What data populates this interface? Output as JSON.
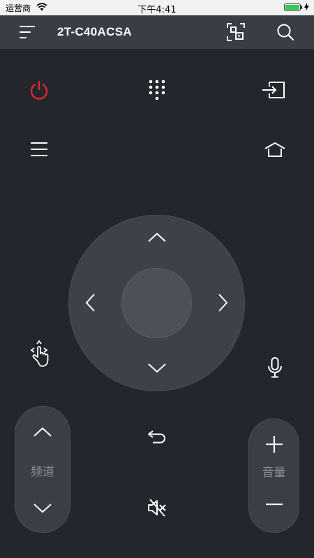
{
  "status_bar": {
    "carrier": "运营商",
    "time": "下午4:41"
  },
  "header": {
    "device_name": "2T-C40ACSA",
    "menu_icon": "sort-lines-icon",
    "screen_cast_icon": "screen-mirror-icon",
    "search_icon": "search-icon"
  },
  "remote": {
    "power_icon": "power-icon",
    "numpad_icon": "numpad-icon",
    "input_icon": "input-source-icon",
    "menu_icon": "menu-icon",
    "home_icon": "home-icon",
    "touch_icon": "touch-gesture-icon",
    "mic_icon": "microphone-icon",
    "back_icon": "back-icon",
    "mute_icon": "mute-icon",
    "channel_label": "频道",
    "volume_label": "音量"
  },
  "colors": {
    "background": "#23262c",
    "header": "#3a3d44",
    "power_red": "#e0282e",
    "battery_green": "#34c759"
  }
}
